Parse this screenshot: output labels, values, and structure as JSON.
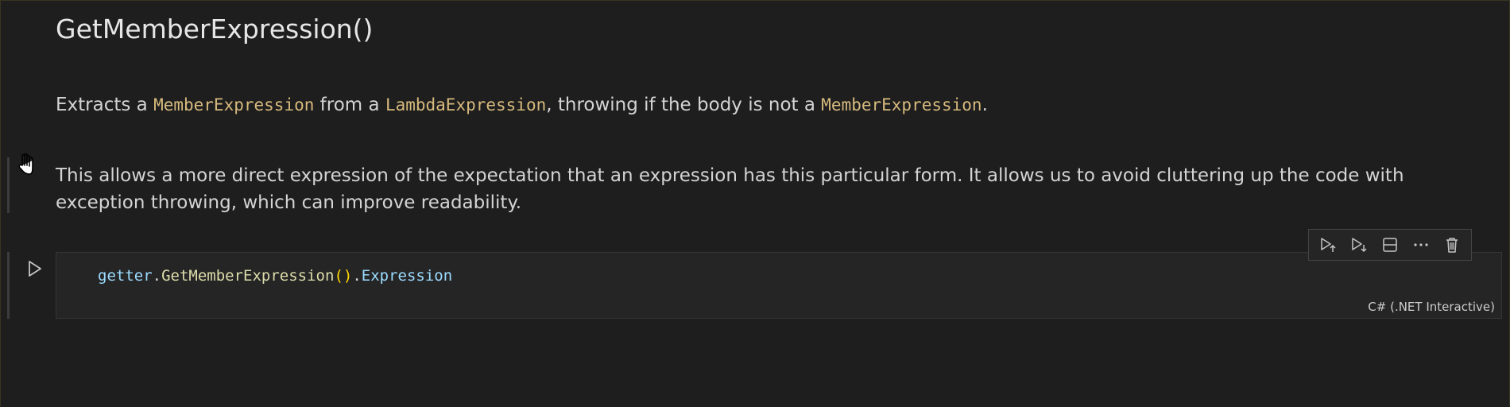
{
  "markdown_cell": {
    "heading": "GetMemberExpression()",
    "paragraph1": {
      "t1": "Extracts a ",
      "c1": "MemberExpression",
      "t2": " from a ",
      "c2": "LambdaExpression",
      "t3": ", throwing if the body is not a ",
      "c3": "MemberExpression",
      "t4": "."
    },
    "paragraph2": "This allows a more direct expression of the expectation that an expression has this particular form. It allows us to avoid cluttering up the code with exception throwing, which can improve readability."
  },
  "code_cell": {
    "tokens": {
      "var": "getter",
      "dot1": ".",
      "fn": "GetMemberExpression",
      "parens": "()",
      "dot2": ".",
      "prop": "Expression"
    },
    "language": "C# (.NET Interactive)"
  },
  "toolbar": {
    "icons": [
      "execute-above-icon",
      "execute-below-icon",
      "split-cell-icon",
      "more-actions-icon",
      "delete-icon"
    ]
  },
  "colors": {
    "background": "#1e1e1e",
    "inline_code": "#d7ba7d",
    "variable": "#9cdcfe",
    "function": "#dcdcaa",
    "bracket": "#ffd700"
  }
}
